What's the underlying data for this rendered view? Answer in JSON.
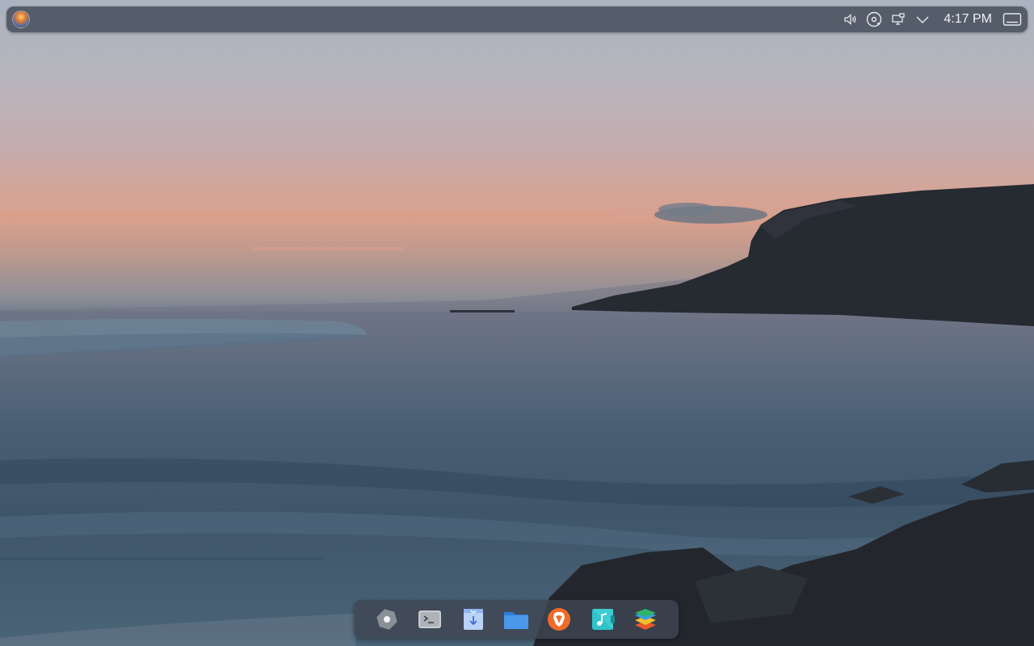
{
  "top_panel": {
    "launcher_icon": "distro-logo-icon",
    "tray": [
      {
        "name": "volume-icon"
      },
      {
        "name": "disc-icon"
      },
      {
        "name": "display-icon"
      },
      {
        "name": "chevron-down-icon"
      }
    ],
    "clock": "4:17 PM",
    "show_desktop_icon": "keyboard-icon"
  },
  "dock": {
    "items": [
      {
        "name": "settings-icon",
        "color": "#8a8f98"
      },
      {
        "name": "terminal-icon",
        "color": "#c9ccd1"
      },
      {
        "name": "installer-icon",
        "color": "#9fc0f0"
      },
      {
        "name": "file-manager-icon",
        "color": "#3f8ee6"
      },
      {
        "name": "brave-browser-icon",
        "color": "#ef5a24"
      },
      {
        "name": "music-player-icon",
        "color": "#2fc4c9"
      },
      {
        "name": "layers-app-icon",
        "color": "#3aa0e0"
      }
    ]
  },
  "colors": {
    "panel": "#4e5663",
    "clock_text": "#eef1f5"
  }
}
